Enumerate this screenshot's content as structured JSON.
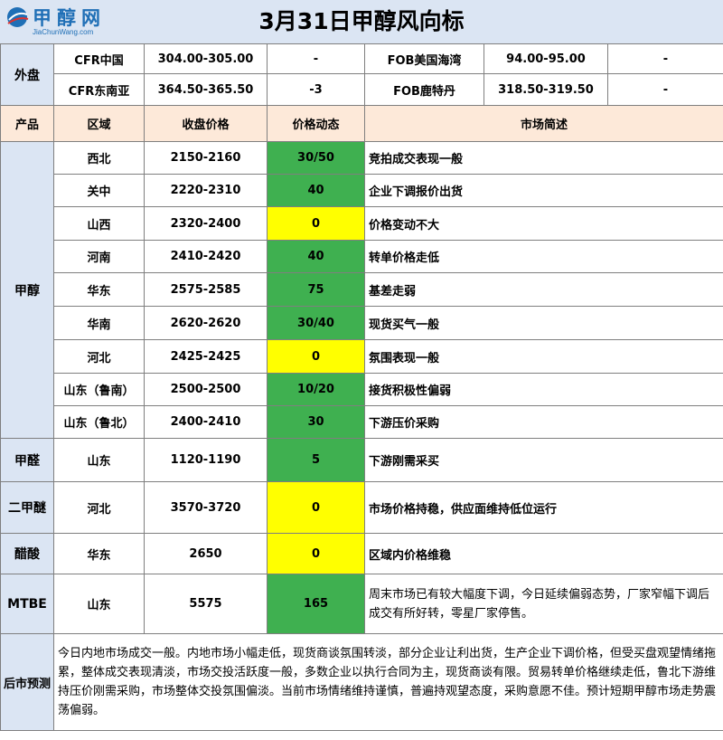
{
  "logo": {
    "cn": "甲醇网",
    "en": "JiaChunWang.com"
  },
  "title": "3月31日甲醇风向标",
  "external": {
    "label": "外盘",
    "rows": [
      {
        "name1": "CFR中国",
        "price1": "304.00-305.00",
        "chg1": "-",
        "name2": "FOB美国海湾",
        "price2": "94.00-95.00",
        "chg2": "-"
      },
      {
        "name1": "CFR东南亚",
        "price1": "364.50-365.50",
        "chg1": "-3",
        "name2": "FOB鹿特丹",
        "price2": "318.50-319.50",
        "chg2": "-"
      }
    ]
  },
  "headers": {
    "product": "产品",
    "region": "区域",
    "price": "收盘价格",
    "change": "价格动态",
    "desc": "市场简述"
  },
  "methanol": {
    "label": "甲醇",
    "rows": [
      {
        "region": "西北",
        "price": "2150-2160",
        "change": "30/50",
        "color": "#3fb050",
        "desc": "竞拍成交表现一般"
      },
      {
        "region": "关中",
        "price": "2220-2310",
        "change": "40",
        "color": "#3fb050",
        "desc": "企业下调报价出货"
      },
      {
        "region": "山西",
        "price": "2320-2400",
        "change": "0",
        "color": "#ffff00",
        "desc": "价格变动不大"
      },
      {
        "region": "河南",
        "price": "2410-2420",
        "change": "40",
        "color": "#3fb050",
        "desc": "转单价格走低"
      },
      {
        "region": "华东",
        "price": "2575-2585",
        "change": "75",
        "color": "#3fb050",
        "desc": "基差走弱"
      },
      {
        "region": "华南",
        "price": "2620-2620",
        "change": "30/40",
        "color": "#3fb050",
        "desc": "现货买气一般"
      },
      {
        "region": "河北",
        "price": "2425-2425",
        "change": "0",
        "color": "#ffff00",
        "desc": "氛围表现一般"
      },
      {
        "region": "山东（鲁南）",
        "price": "2500-2500",
        "change": "10/20",
        "color": "#3fb050",
        "desc": "接货积极性偏弱"
      },
      {
        "region": "山东（鲁北）",
        "price": "2400-2410",
        "change": "30",
        "color": "#3fb050",
        "desc": "下游压价采购"
      }
    ]
  },
  "others": [
    {
      "product": "甲醛",
      "region": "山东",
      "price": "1120-1190",
      "change": "5",
      "color": "#3fb050",
      "desc": "下游刚需采买"
    },
    {
      "product": "二甲醚",
      "region": "河北",
      "price": "3570-3720",
      "change": "0",
      "color": "#ffff00",
      "desc": "市场价格持稳，供应面维持低位运行"
    },
    {
      "product": "醋酸",
      "region": "华东",
      "price": "2650",
      "change": "0",
      "color": "#ffff00",
      "desc": "区域内价格维稳"
    },
    {
      "product": "MTBE",
      "region": "山东",
      "price": "5575",
      "change": "165",
      "color": "#3fb050",
      "desc": "周末市场已有较大幅度下调，今日延续偏弱态势，厂家窄幅下调后成交有所好转，零星厂家停售。"
    }
  ],
  "forecast": {
    "label": "后市预测",
    "text": "今日内地市场成交一般。内地市场小幅走低，现货商谈氛围转淡，部分企业让利出货，生产企业下调价格，但受买盘观望情绪拖累，整体成交表现清淡，市场交投活跃度一般，多数企业以执行合同为主，现货商谈有限。贸易转单价格继续走低，鲁北下游维持压价刚需采购，市场整体交投氛围偏淡。当前市场情绪维持谨慎，普遍持观望态度，采购意愿不佳。预计短期甲醇市场走势震荡偏弱。"
  }
}
